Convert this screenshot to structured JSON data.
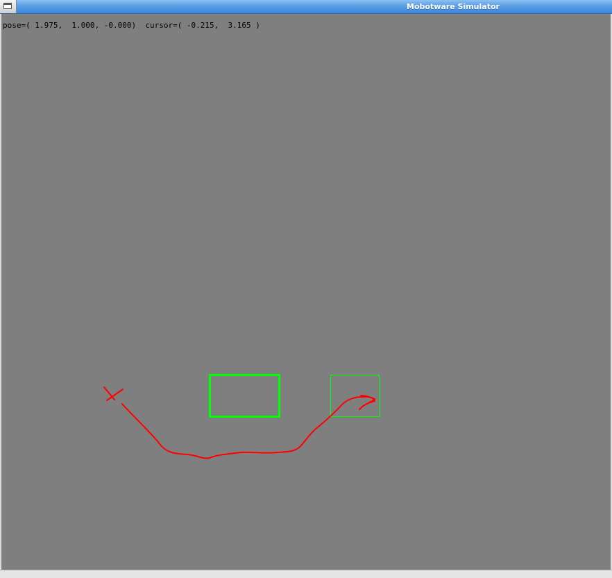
{
  "window": {
    "title": "Mobotware Simulator",
    "menu_icon": "window-menu-icon"
  },
  "status": {
    "pose_label": "pose=",
    "pose_value": "( 1.975,  1.000, -0.000)",
    "cursor_label": "cursor=",
    "cursor_value": "( -0.215,  3.165 )"
  },
  "colors": {
    "canvas_background": "#7f7f7f",
    "robot_outline": "#00ff00",
    "goal_outline": "#00ff00",
    "annotation": "#ff0000"
  },
  "annotations": {
    "start_marker_icon": "x-mark-icon",
    "path_icon": "curved-arrow-icon"
  }
}
